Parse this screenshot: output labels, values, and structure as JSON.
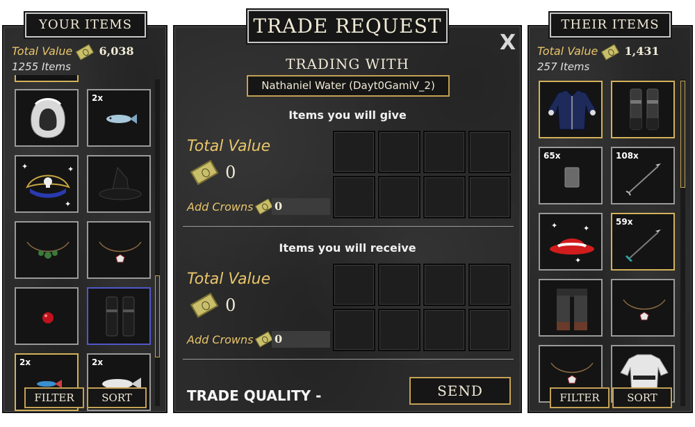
{
  "left_panel": {
    "title": "YOUR ITEMS",
    "total_value_label": "Total Value",
    "total_value": "6,038",
    "item_count": "1255 Items",
    "slots": [
      {
        "qty": "",
        "item": "hood"
      },
      {
        "qty": "2x",
        "item": "fish"
      },
      {
        "qty": "",
        "item": "pirate-hat"
      },
      {
        "qty": "",
        "item": "witch-hat"
      },
      {
        "qty": "",
        "item": "green-necklace"
      },
      {
        "qty": "",
        "item": "silver-necklace"
      },
      {
        "qty": "",
        "item": "red-orb"
      },
      {
        "qty": "",
        "item": "dark-boots"
      },
      {
        "qty": "2x",
        "item": "blue-fish"
      },
      {
        "qty": "2x",
        "item": "white-fish"
      }
    ],
    "filter_label": "FILTER",
    "sort_label": "SORT"
  },
  "trade": {
    "title": "TRADE REQUEST",
    "close_label": "X",
    "trading_with_label": "TRADING WITH",
    "partner": "Nathaniel Water (Dayt0GamiV_2)",
    "give_heading": "Items you will give",
    "receive_heading": "Items you will receive",
    "total_value_label": "Total Value",
    "give_value": "0",
    "receive_value": "0",
    "add_crowns_label": "Add Crowns",
    "give_crowns": "0",
    "receive_crowns": "0",
    "quality_label": "TRADE QUALITY -",
    "send_label": "SEND"
  },
  "right_panel": {
    "title": "THEIR ITEMS",
    "total_value_label": "Total Value",
    "total_value": "1,431",
    "item_count": "257 Items",
    "slots": [
      {
        "qty": "",
        "item": "navy-coat"
      },
      {
        "qty": "",
        "item": "grey-boots"
      },
      {
        "qty": "65x",
        "item": "grey-card"
      },
      {
        "qty": "108x",
        "item": "arrow"
      },
      {
        "qty": "",
        "item": "red-hat"
      },
      {
        "qty": "59x",
        "item": "teal-arrow"
      },
      {
        "qty": "",
        "item": "grey-pants"
      },
      {
        "qty": "",
        "item": "silver-necklace"
      },
      {
        "qty": "",
        "item": "bronze-necklace"
      },
      {
        "qty": "",
        "item": "white-armor"
      }
    ],
    "filter_label": "FILTER",
    "sort_label": "SORT"
  },
  "colors": {
    "gold_accent": "#e8c56b",
    "panel_bg": "#2b2b2b",
    "plaque_border": "#c8c8c8",
    "selected_border": "#d3b25a",
    "highlight_border": "#5058c8"
  }
}
